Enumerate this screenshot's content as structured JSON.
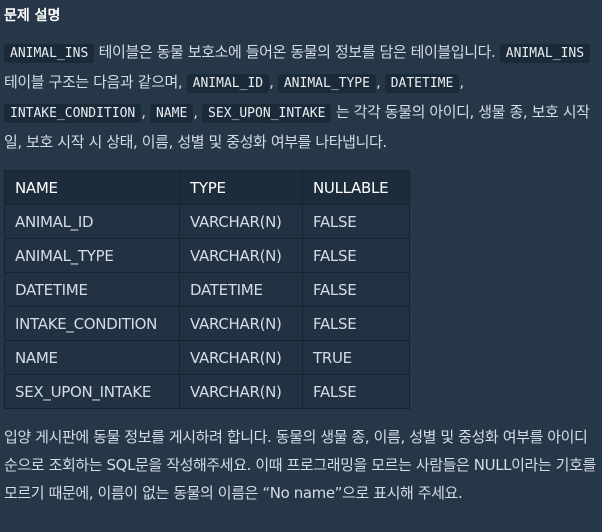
{
  "section": {
    "title": "문제 설명"
  },
  "intro": {
    "table_name": "ANIMAL_INS",
    "line1_rest": "테이블은 동물 보호소에 들어온 동물의 정보를 담은 테이블입니다.",
    "table_name_2": "ANIMAL_INS",
    "line2_rest": "테이블 구조는 다음과 같으며,",
    "columns": [
      "ANIMAL_ID",
      "ANIMAL_TYPE",
      "DATETIME",
      "INTAKE_CONDITION",
      "NAME",
      "SEX_UPON_INTAKE"
    ],
    "separator": ",",
    "tail": "는 각각 동물의 아이디, 생물 종, 보호 시작일, 보호 시작 시 상태, 이름, 성별 및 중성화 여부를 나타냅니다."
  },
  "schema_table": {
    "headers": [
      "NAME",
      "TYPE",
      "NULLABLE"
    ],
    "rows": [
      [
        "ANIMAL_ID",
        "VARCHAR(N)",
        "FALSE"
      ],
      [
        "ANIMAL_TYPE",
        "VARCHAR(N)",
        "FALSE"
      ],
      [
        "DATETIME",
        "DATETIME",
        "FALSE"
      ],
      [
        "INTAKE_CONDITION",
        "VARCHAR(N)",
        "FALSE"
      ],
      [
        "NAME",
        "VARCHAR(N)",
        "TRUE"
      ],
      [
        "SEX_UPON_INTAKE",
        "VARCHAR(N)",
        "FALSE"
      ]
    ]
  },
  "task": {
    "text": "입양 게시판에 동물 정보를 게시하려 합니다. 동물의 생물 종, 이름, 성별 및 중성화 여부를 아이디 순으로 조회하는 SQL문을 작성해주세요. 이때 프로그래밍을 모르는 사람들은 NULL이라는 기호를 모르기 때문에, 이름이 없는 동물의 이름은 “No name”으로 표시해 주세요."
  }
}
